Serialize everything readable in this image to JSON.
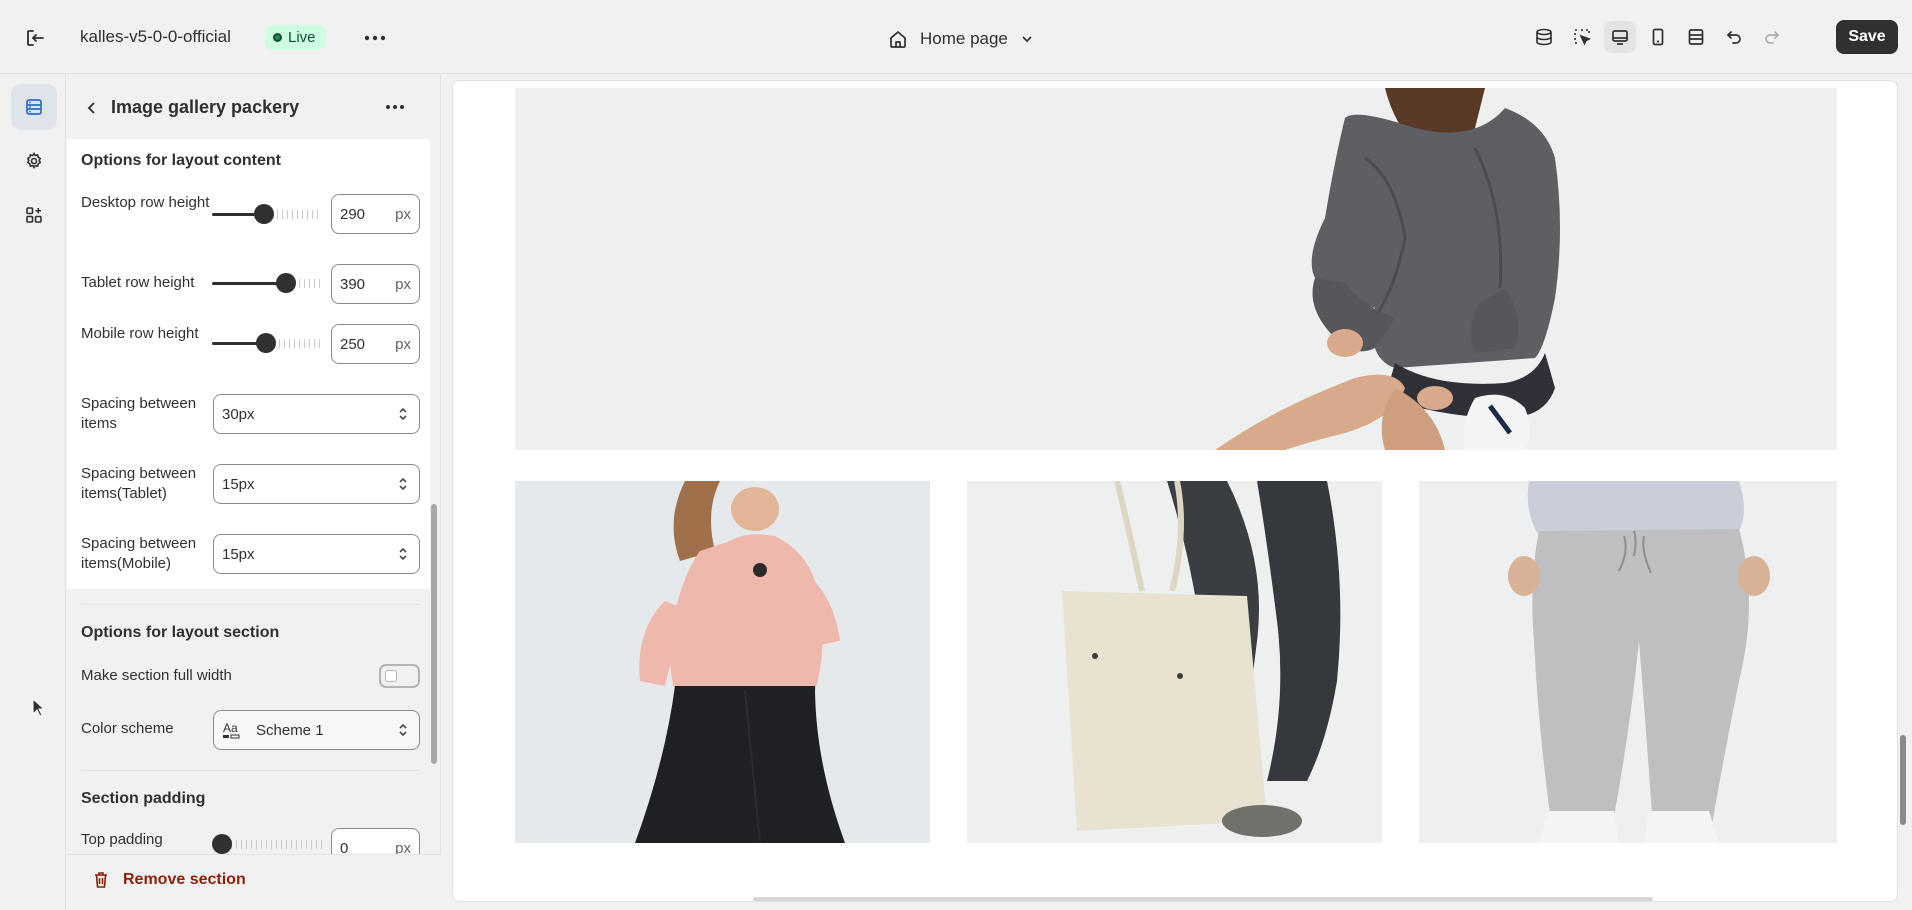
{
  "topbar": {
    "store_name": "kalles-v5-0-0-official",
    "status_badge": "Live",
    "page_selector": "Home page",
    "save_label": "Save"
  },
  "panel": {
    "title": "Image gallery packery",
    "layout_content": {
      "title": "Options for layout content",
      "desktop_row_height": {
        "label": "Desktop row height",
        "value": "290",
        "unit": "px",
        "fraction": 0.47
      },
      "tablet_row_height": {
        "label": "Tablet row height",
        "value": "390",
        "unit": "px",
        "fraction": 0.68
      },
      "mobile_row_height": {
        "label": "Mobile row height",
        "value": "250",
        "unit": "px",
        "fraction": 0.48
      },
      "spacing_items": {
        "label": "Spacing between items",
        "value": "30px"
      },
      "spacing_items_tablet": {
        "label": "Spacing between items(Tablet)",
        "value": "15px"
      },
      "spacing_items_mobile": {
        "label": "Spacing between items(Mobile)",
        "value": "15px"
      }
    },
    "layout_section": {
      "title": "Options for layout section",
      "full_width": {
        "label": "Make section full width",
        "checked": false
      },
      "color_scheme": {
        "label": "Color scheme",
        "value": "Scheme 1"
      }
    },
    "section_padding": {
      "title": "Section padding",
      "top_padding": {
        "label": "Top padding",
        "value": "0",
        "unit": "px"
      }
    },
    "remove_label": "Remove section"
  },
  "preview": {
    "images": [
      {
        "name": "model-grey-sweatshirt",
        "description": "woman in grey sweatshirt sitting"
      },
      {
        "name": "model-pink-blouse"
      },
      {
        "name": "model-tote-bag"
      },
      {
        "name": "model-grey-joggers"
      }
    ]
  },
  "colors": {
    "accent_dark": "#303030",
    "live_badge_bg": "#cdfee1",
    "remove_red": "#8e1f0b",
    "panel_bg": "#f1f1f1"
  }
}
